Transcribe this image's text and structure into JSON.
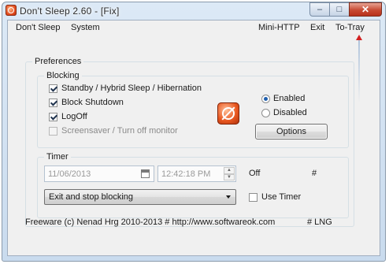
{
  "window": {
    "title": "Don't Sleep 2.60 - [Fix]",
    "minimize_glyph": "–",
    "maximize_glyph": "□",
    "close_glyph": "✕"
  },
  "menu": {
    "dont_sleep": "Don't Sleep",
    "system": "System",
    "mini_http": "Mini-HTTP",
    "exit": "Exit",
    "to_tray": "To-Tray"
  },
  "preferences": {
    "label": "Preferences",
    "blocking": {
      "label": "Blocking",
      "options": [
        {
          "label": "Standby / Hybrid Sleep / Hibernation",
          "checked": true
        },
        {
          "label": "Block Shutdown",
          "checked": true
        },
        {
          "label": "LogOff",
          "checked": true
        },
        {
          "label": "Screensaver / Turn off monitor",
          "checked": false
        }
      ],
      "enabled_label": "Enabled",
      "disabled_label": "Disabled",
      "state": "enabled",
      "options_button": "Options"
    },
    "timer": {
      "label": "Timer",
      "date": "11/06/2013",
      "time": "12:42:18 PM",
      "status": "Off",
      "hash": "#",
      "action": "Exit and stop blocking",
      "use_timer_label": "Use Timer",
      "use_timer_checked": false
    }
  },
  "footer": {
    "copyright": "Freeware (c) Nenad Hrg 2010-2013 # http://www.softwareok.com",
    "language": "# LNG"
  },
  "colors": {
    "accent": "#1f5fae",
    "close_button": "#c74a33",
    "tray_arrow": "#d22020"
  }
}
